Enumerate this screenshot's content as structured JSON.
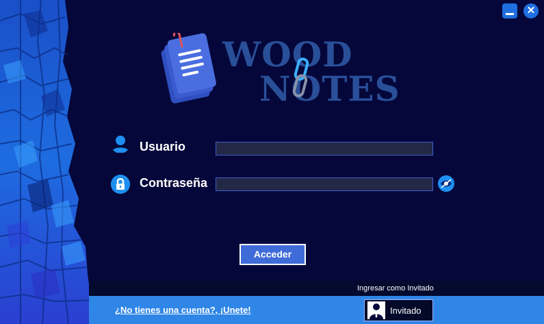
{
  "window": {
    "minimize_icon": "minimize-icon",
    "close_icon": "close-icon",
    "close_glyph": "✕"
  },
  "logo": {
    "line1": "WOOD",
    "line2": "NOTES",
    "icon": "document-stack-icon",
    "colors": {
      "text": "#2a4f99",
      "pages": "#3f63d9",
      "chain": "#3bb0ff"
    }
  },
  "form": {
    "user_label": "Usuario",
    "user_icon": "user-icon",
    "user_value": "",
    "password_label": "Contraseña",
    "password_icon": "lock-icon",
    "password_value": "",
    "toggle_visibility_icon": "eye-icon",
    "submit_label": "Acceder"
  },
  "footer": {
    "guest_caption": "Ingresar como Invitado",
    "signup_link": "¿No tienes una cuenta?, ¡Unete!",
    "guest_button_label": "Invitado",
    "guest_icon": "guest-user-icon"
  },
  "colors": {
    "background": "#05073a",
    "accent": "#1f6fe0",
    "bottom_bar": "#2f86e6",
    "input_bg": "#232846"
  }
}
